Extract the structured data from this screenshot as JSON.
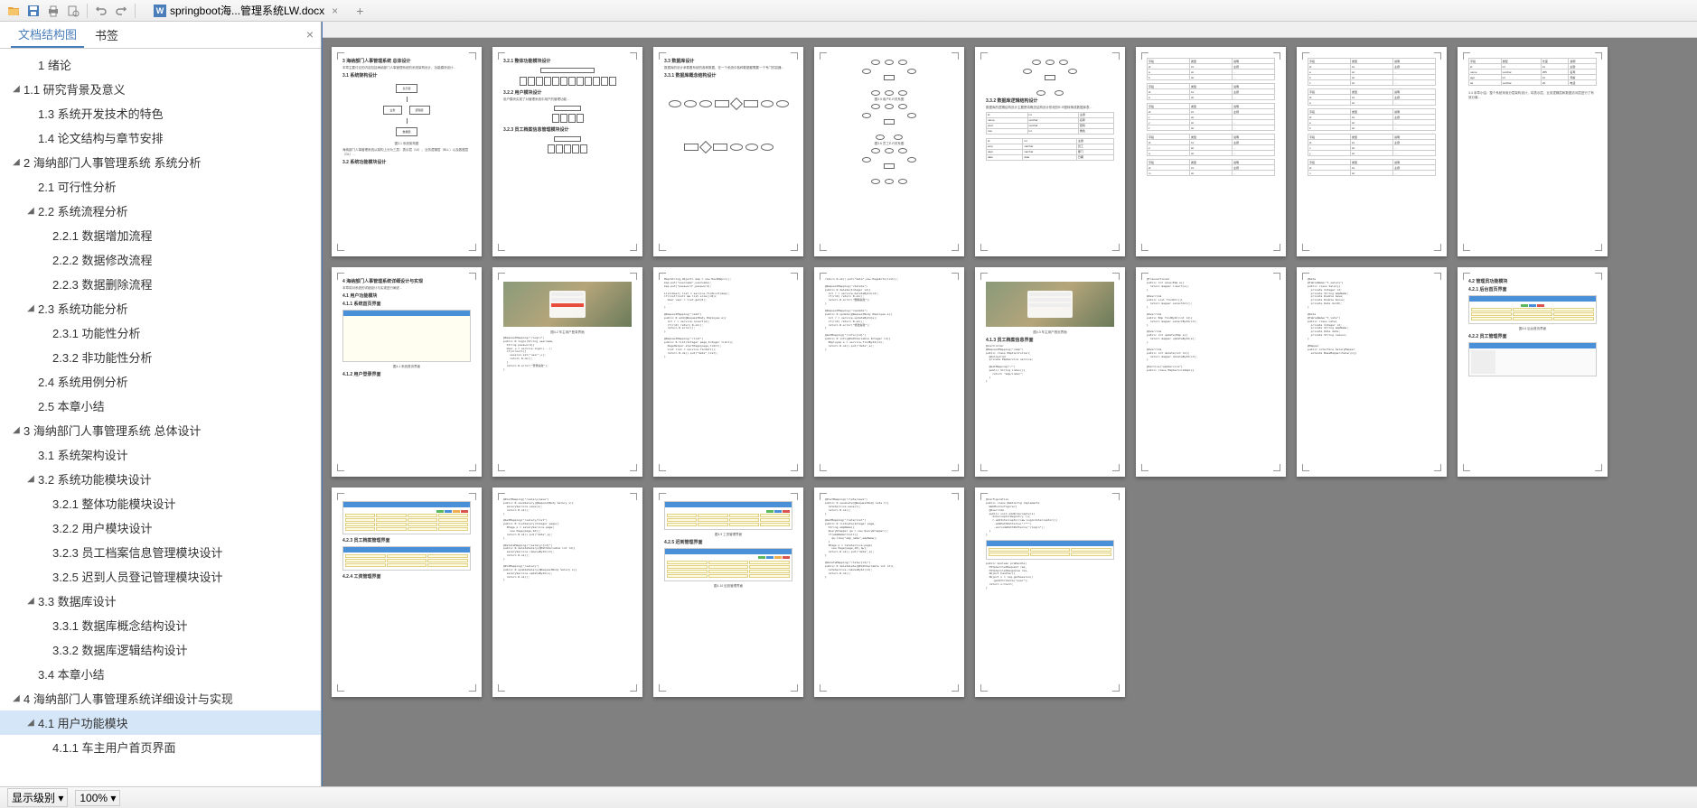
{
  "toolbar": {
    "doc_title": "springboot海...管理系统LW.docx"
  },
  "sidebar": {
    "tab_outline": "文档结构图",
    "tab_bookmark": "书签",
    "items": [
      {
        "level": 2,
        "toggle": "",
        "label": "1 绪论"
      },
      {
        "level": 1,
        "toggle": "◢",
        "label": "1.1 研究背景及意义"
      },
      {
        "level": 2,
        "toggle": "",
        "label": "1.3 系统开发技术的特色"
      },
      {
        "level": 2,
        "toggle": "",
        "label": "1.4 论文结构与章节安排"
      },
      {
        "level": 1,
        "toggle": "◢",
        "label": "2 海纳部门人事管理系统 系统分析"
      },
      {
        "level": 2,
        "toggle": "",
        "label": "2.1 可行性分析"
      },
      {
        "level": 2,
        "toggle": "◢",
        "label": "2.2 系统流程分析"
      },
      {
        "level": 3,
        "toggle": "",
        "label": "2.2.1 数据增加流程"
      },
      {
        "level": 3,
        "toggle": "",
        "label": "2.2.2 数据修改流程"
      },
      {
        "level": 3,
        "toggle": "",
        "label": "2.2.3 数据删除流程"
      },
      {
        "level": 2,
        "toggle": "◢",
        "label": "2.3 系统功能分析"
      },
      {
        "level": 3,
        "toggle": "",
        "label": "2.3.1 功能性分析"
      },
      {
        "level": 3,
        "toggle": "",
        "label": "2.3.2 非功能性分析"
      },
      {
        "level": 2,
        "toggle": "",
        "label": "2.4 系统用例分析"
      },
      {
        "level": 2,
        "toggle": "",
        "label": "2.5 本章小结"
      },
      {
        "level": 1,
        "toggle": "◢",
        "label": "3 海纳部门人事管理系统 总体设计"
      },
      {
        "level": 2,
        "toggle": "",
        "label": "3.1 系统架构设计"
      },
      {
        "level": 2,
        "toggle": "◢",
        "label": "3.2 系统功能模块设计"
      },
      {
        "level": 3,
        "toggle": "",
        "label": "3.2.1 整体功能模块设计"
      },
      {
        "level": 3,
        "toggle": "",
        "label": "3.2.2 用户模块设计"
      },
      {
        "level": 3,
        "toggle": "",
        "label": "3.2.3 员工档案信息管理模块设计"
      },
      {
        "level": 3,
        "toggle": "",
        "label": "3.2.5 迟到人员登记管理模块设计"
      },
      {
        "level": 2,
        "toggle": "◢",
        "label": "3.3 数据库设计"
      },
      {
        "level": 3,
        "toggle": "",
        "label": "3.3.1 数据库概念结构设计"
      },
      {
        "level": 3,
        "toggle": "",
        "label": "3.3.2 数据库逻辑结构设计"
      },
      {
        "level": 2,
        "toggle": "",
        "label": "3.4 本章小结"
      },
      {
        "level": 1,
        "toggle": "◢",
        "label": "4 海纳部门人事管理系统详细设计与实现"
      },
      {
        "level": 2,
        "toggle": "◢",
        "label": "4.1 用户功能模块",
        "selected": true
      },
      {
        "level": 3,
        "toggle": "",
        "label": "4.1.1 车主用户首页界面"
      }
    ]
  },
  "statusbar": {
    "level_label": "显示级别",
    "zoom": "100%"
  },
  "pages": {
    "p1_title": "3 海纳部门人事管理系统 总体设计",
    "p1_sub1": "3.1 系统架构设计",
    "p1_caption": "图3.1 系统架构图",
    "p1_sub2": "3.2 系统功能模块设计",
    "p2_t1": "3.2.1 整体功能模块设计",
    "p2_t2": "3.2.2 用户模块设计",
    "p2_t3": "3.2.3 员工档案信息管理模块设计",
    "p3_t1": "3.3 数据库设计",
    "p3_t2": "3.3.1 数据库概念结构设计",
    "p4_caption1": "图3.5 用户E-R关系图",
    "p4_caption2": "图3.6 员工E-R关系图",
    "p5_t1": "3.3.2 数据库逻辑结构设计",
    "p8_t1": "4 海纳部门人事管理系统详细设计与实现",
    "p8_t2": "4.1 用户功能模块",
    "p8_t3": "4.1.1 系统首页界面",
    "p8_caption": "图4.1 系统首页界面",
    "p8_t4": "4.1.2 用户登录界面",
    "p9_caption": "图4.2 车主用户登录界面",
    "p12_caption": "图4.3 车主用户首页界面",
    "p12_t1": "4.1.3 员工档案信息界面",
    "p15_t1": "4.2 管理员功能模块",
    "p15_t2": "4.2.1 后台首页界面",
    "p15_caption": "图4.6 后台首页界面",
    "p15_t3": "4.2.2 员工管理界面",
    "p16_t1": "4.2.3 员工档案管理界面",
    "p16_t2": "4.2.4 工资管理界面",
    "p17_caption1": "图4.9 工资管理界面",
    "p17_t1": "4.2.5 迟到管理界面",
    "p17_caption2": "图4.10 迟到管理界面"
  }
}
